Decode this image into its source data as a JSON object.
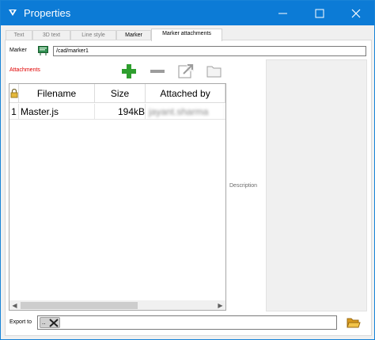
{
  "window": {
    "title": "Properties"
  },
  "tabs": [
    {
      "label": "Text"
    },
    {
      "label": "3D text"
    },
    {
      "label": "Line style"
    },
    {
      "label": "Marker"
    },
    {
      "label": "Marker attachments"
    }
  ],
  "marker": {
    "label": "Marker",
    "path": "/cad/marker1"
  },
  "attachments": {
    "label": "Attachments",
    "toolbar": [
      "add-icon",
      "remove-icon",
      "open-external-icon",
      "folder-icon"
    ],
    "columns": [
      "Filename",
      "Size",
      "Attached by"
    ],
    "rows": [
      {
        "index": "1",
        "filename": "Master.js",
        "size": "194kB",
        "attached_by": "jayant.sharma"
      }
    ]
  },
  "description": {
    "label": "Description"
  },
  "export": {
    "label": "Export to",
    "chip_text": ".."
  },
  "colors": {
    "title_bar": "#0c7bd6",
    "attachments_label": "#e00000",
    "add_icon": "#2e9e2e"
  }
}
